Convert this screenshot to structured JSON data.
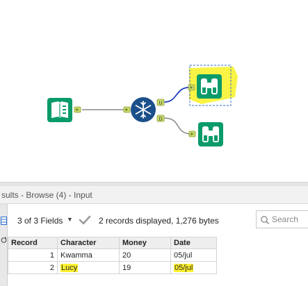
{
  "workflow": {
    "tools": [
      {
        "name": "input-book-tool",
        "icon": "book-icon"
      },
      {
        "name": "join-tool",
        "icon": "snowflake-icon"
      },
      {
        "name": "browse-tool-u",
        "icon": "binoculars-icon"
      },
      {
        "name": "browse-tool-d",
        "icon": "binoculars-icon"
      }
    ],
    "anchors": {
      "unique": "U",
      "duplicate": "D"
    },
    "colors": {
      "tool_green": "#0a9b6a",
      "join_blue": "#1a4f8a",
      "highlight": "#fff230",
      "selection": "#2e6cd1"
    }
  },
  "results": {
    "title": "sults - Browse (4) - Input",
    "fields_label": "3 of 3 Fields",
    "records_text": "2 records displayed, 1,276 bytes",
    "search_placeholder": "Search"
  },
  "table": {
    "headers": [
      "Record",
      "Character",
      "Money",
      "Date"
    ],
    "rows": [
      {
        "record": "1",
        "character": "Kwamma",
        "money": "20",
        "date": "05/jul"
      },
      {
        "record": "2",
        "character": "Lucy",
        "money": "19",
        "date": "05/jul"
      }
    ]
  }
}
